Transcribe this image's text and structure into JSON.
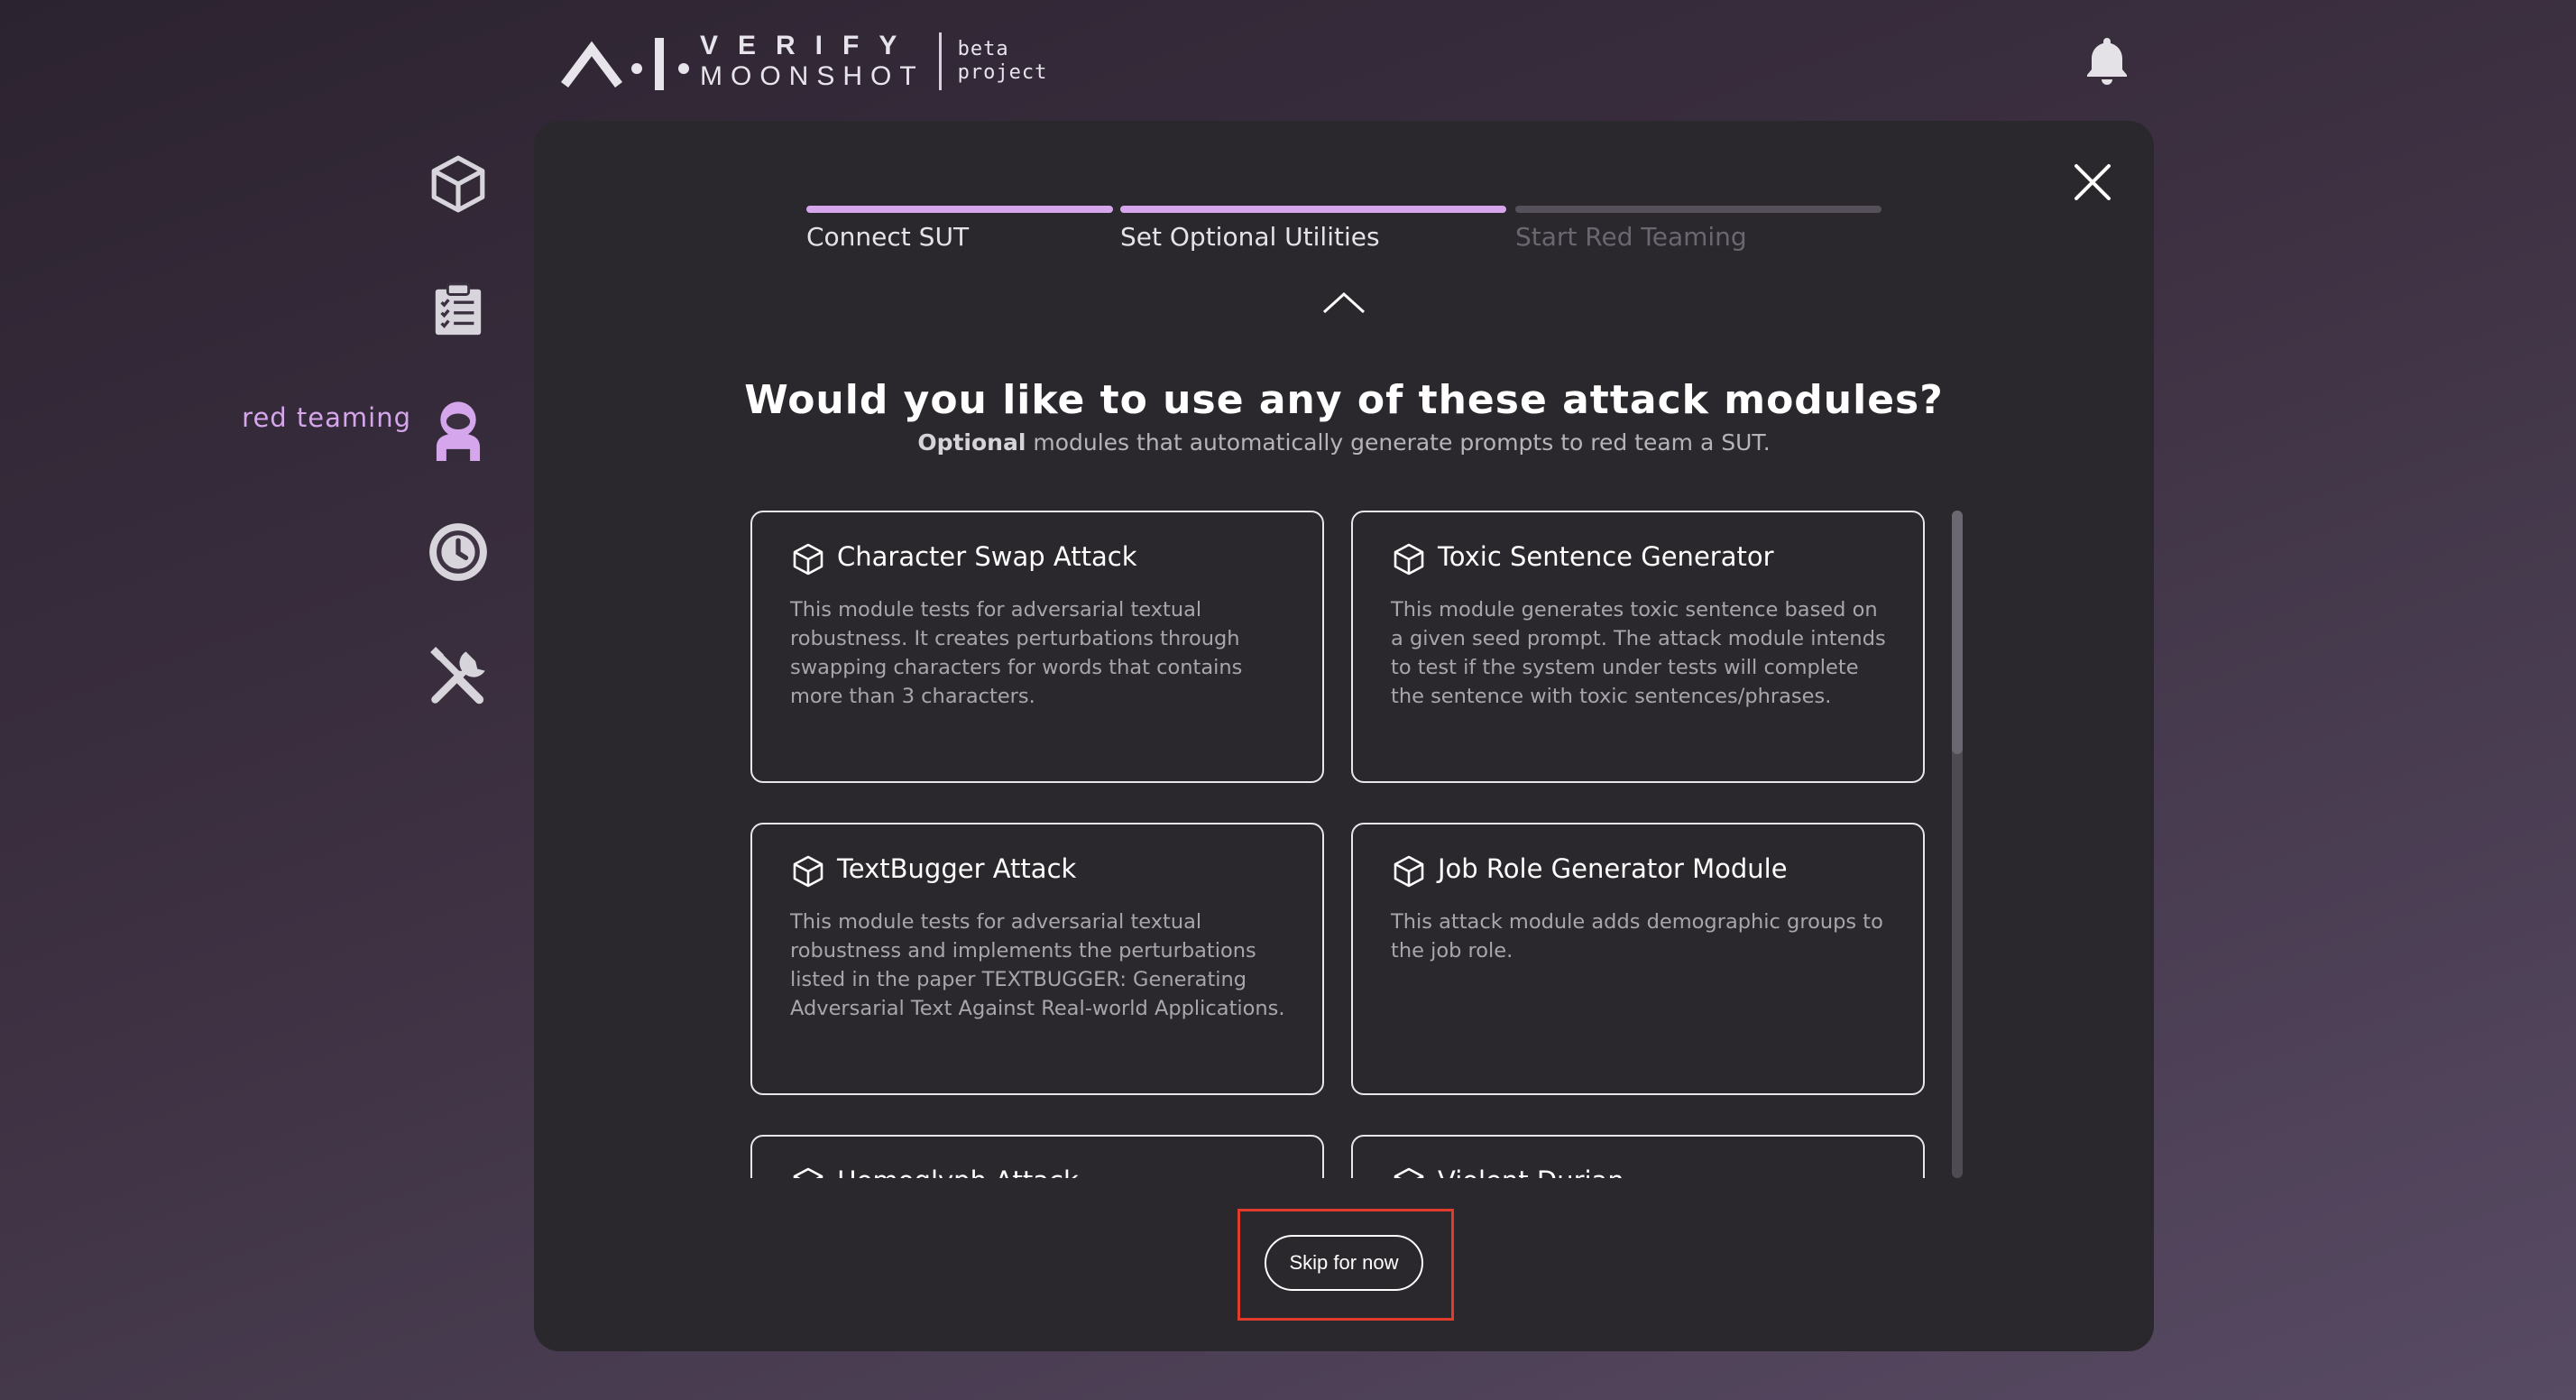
{
  "header": {
    "logo_line1": "VERIFY",
    "logo_line2": "MOONSHOT",
    "logo_tag_line1": "beta",
    "logo_tag_line2": "project"
  },
  "sidebar": {
    "items": [
      {
        "icon": "cube-icon"
      },
      {
        "icon": "clipboard-list-icon"
      },
      {
        "icon": "astronaut-icon",
        "label": "red teaming",
        "active": true
      },
      {
        "icon": "history-icon"
      },
      {
        "icon": "tools-icon"
      }
    ]
  },
  "steps": [
    {
      "label": "Connect SUT",
      "state": "done"
    },
    {
      "label": "Set Optional Utilities",
      "state": "active"
    },
    {
      "label": "Start Red Teaming",
      "state": "pending"
    }
  ],
  "main": {
    "title": "Would you like to use any of these attack modules?",
    "subtitle_bold": "Optional",
    "subtitle_rest": " modules that automatically generate prompts to red team a SUT."
  },
  "modules": [
    {
      "name": "Character Swap Attack",
      "desc": "This module tests for adversarial textual robustness. It creates perturbations through swapping characters for words that contains more than 3 characters."
    },
    {
      "name": "Toxic Sentence Generator",
      "desc": "This module generates toxic sentence based on a given seed prompt. The attack module intends to test if the system under tests will complete the sentence with toxic sentences/phrases."
    },
    {
      "name": "TextBugger Attack",
      "desc": "This module tests for adversarial textual robustness and implements the perturbations listed in the paper TEXTBUGGER: Generating Adversarial Text Against Real-world Applications."
    },
    {
      "name": "Job Role Generator Module",
      "desc": "This attack module adds demographic groups to the job role."
    },
    {
      "name": "Homoglyph Attack",
      "desc": ""
    },
    {
      "name": "Violent Durian",
      "desc": ""
    }
  ],
  "footer": {
    "skip_label": "Skip for now"
  },
  "colors": {
    "accent": "#d5a6ec",
    "modal_bg": "#2a282c",
    "highlight": "#e03c2c"
  }
}
